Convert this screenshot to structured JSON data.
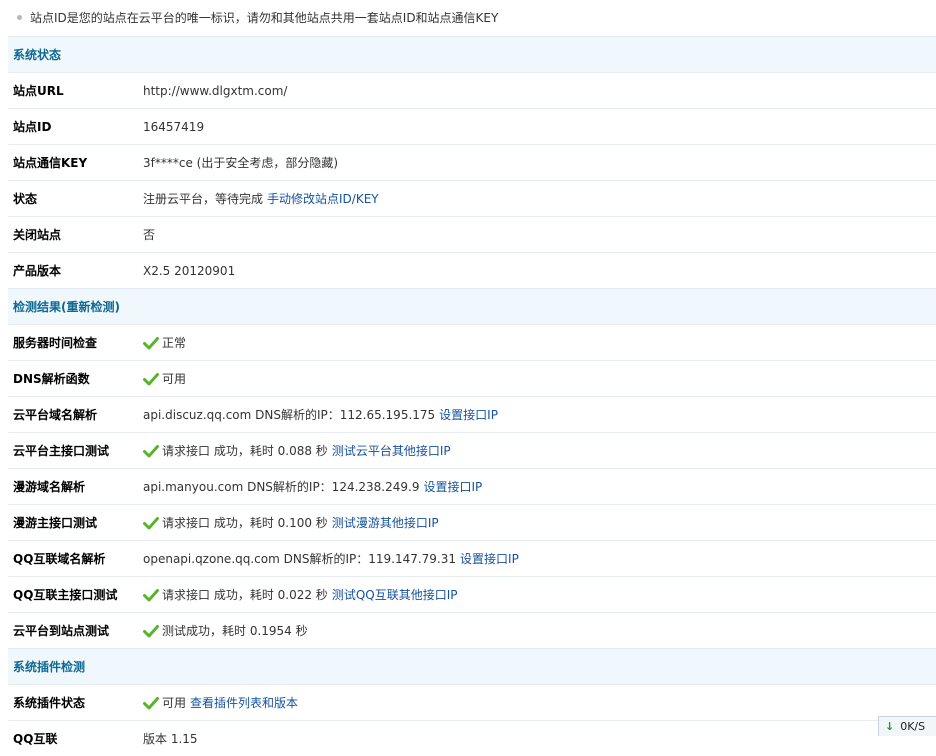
{
  "tip": {
    "text": "站点ID是您的站点在云平台的唯一标识，请勿和其他站点共用一套站点ID和站点通信KEY"
  },
  "sections": {
    "status": "系统状态",
    "check": "检测结果(重新检测)",
    "plugins": "系统插件检测"
  },
  "status": {
    "url_label": "站点URL",
    "url_value": "http://www.dlgxtm.com/",
    "id_label": "站点ID",
    "id_value": "16457419",
    "key_label": "站点通信KEY",
    "key_value": "3f****ce (出于安全考虑，部分隐藏)",
    "state_label": "状态",
    "state_value": "注册云平台，等待完成",
    "state_link": "手动修改站点ID/KEY",
    "closed_label": "关闭站点",
    "closed_value": "否",
    "version_label": "产品版本",
    "version_value": "X2.5 20120901"
  },
  "check": {
    "server_time_label": "服务器时间检查",
    "server_time_value": "正常",
    "dns_func_label": "DNS解析函数",
    "dns_func_value": "可用",
    "cloud_dns_label": "云平台域名解析",
    "cloud_dns_value": "api.discuz.qq.com DNS解析的IP：112.65.195.175",
    "cloud_dns_link": "设置接口IP",
    "cloud_api_label": "云平台主接口测试",
    "cloud_api_value": "请求接口 成功，耗时 0.088 秒",
    "cloud_api_link": "测试云平台其他接口IP",
    "manyou_dns_label": "漫游域名解析",
    "manyou_dns_value": "api.manyou.com DNS解析的IP：124.238.249.9",
    "manyou_dns_link": "设置接口IP",
    "manyou_api_label": "漫游主接口测试",
    "manyou_api_value": "请求接口 成功，耗时 0.100 秒",
    "manyou_api_link": "测试漫游其他接口IP",
    "qq_dns_label": "QQ互联域名解析",
    "qq_dns_value": "openapi.qzone.qq.com DNS解析的IP：119.147.79.31",
    "qq_dns_link": "设置接口IP",
    "qq_api_label": "QQ互联主接口测试",
    "qq_api_value": "请求接口 成功，耗时 0.022 秒",
    "qq_api_link": "测试QQ互联其他接口IP",
    "site_test_label": "云平台到站点测试",
    "site_test_value": "测试成功，耗时 0.1954 秒"
  },
  "plugins": {
    "state_label": "系统插件状态",
    "state_value": "可用",
    "state_link": "查看插件列表和版本",
    "partial_label": "QQ互联",
    "partial_value": "版本 1.15"
  },
  "statusbar": {
    "speed": "0K/S"
  },
  "colors": {
    "section_bg": "#f0f7fd",
    "section_text": "#0e6a93",
    "link": "#14529e",
    "check_green": "#58b42c"
  },
  "icons": {
    "ok": "check-icon",
    "download": "down-arrow-icon",
    "bullet": "bullet-dot"
  }
}
